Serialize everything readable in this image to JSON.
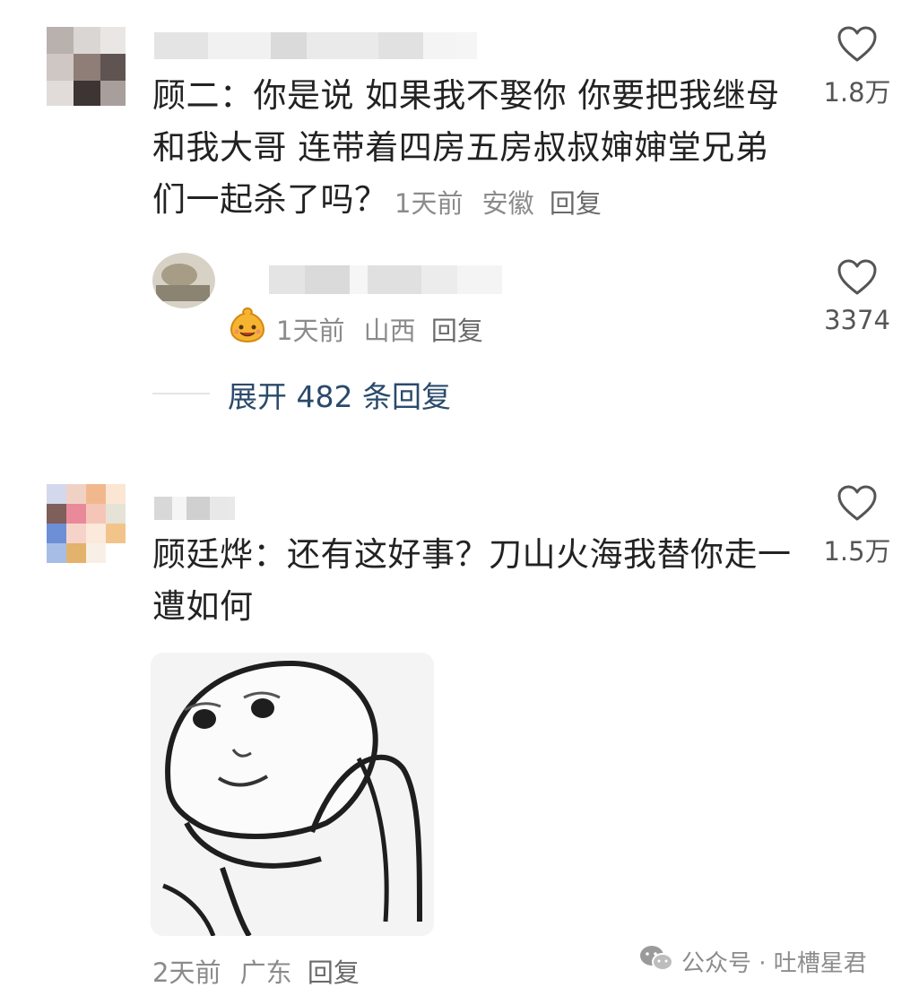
{
  "comments": [
    {
      "text": "顾二：你是说 如果我不娶你 你要把我继母和我大哥 连带着四房五房叔叔婶婶堂兄弟们一起杀了吗？",
      "time": "1天前",
      "location": "安徽",
      "reply_label": "回复",
      "likes": "1.8万"
    },
    {
      "text": "顾廷烨：还有这好事？刀山火海我替你走一遭如何",
      "time": "2天前",
      "location": "广东",
      "reply_label": "回复",
      "likes": "1.5万"
    }
  ],
  "reply": {
    "time": "1天前",
    "location": "山西",
    "reply_label": "回复",
    "likes": "3374"
  },
  "expand_replies": "展开 482 条回复",
  "watermark": "公众号 · 吐槽星君",
  "colors": {
    "text": "#222222",
    "meta": "#8b8b8b",
    "link": "#2b4a6b",
    "heart": "#555555"
  }
}
